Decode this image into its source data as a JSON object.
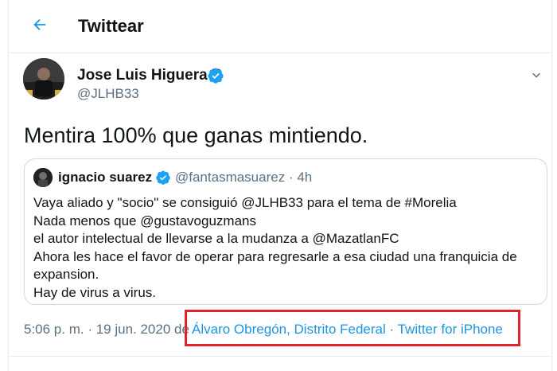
{
  "header": {
    "title": "Twittear",
    "back_icon": "arrow-left-icon"
  },
  "tweet": {
    "author_name": "Jose Luis Higuera B",
    "author_handle": "@JLHB33",
    "text": "Mentira 100% que ganas mintiendo.",
    "timestamp": "5:06 p. m. · 19 jun. 2020 de",
    "location": "Álvaro Obregón, Distrito Federal",
    "separator": "·",
    "source": "Twitter for iPhone"
  },
  "quote": {
    "author_name": "ignacio suarez",
    "author_handle": "@fantasmasuarez · 4h",
    "lines": [
      "Vaya aliado y \"socio\" se consiguió @JLHB33 para el tema de #Morelia",
      "Nada menos que @gustavoguzmans",
      "el autor intelectual de llevarse a la mudanza a @MazatlanFC",
      "Ahora les hace el favor de operar para regresarle a esa ciudad una franquicia de",
      "expansion.",
      "Hay de virus a virus."
    ]
  },
  "colors": {
    "accent": "#1b95e0",
    "highlight": "#e5202a",
    "secondary_text": "#5b7083",
    "verified": "#1da1f2"
  },
  "icons": [
    "arrow-left-icon",
    "verified-badge-icon",
    "chevron-down-icon"
  ]
}
